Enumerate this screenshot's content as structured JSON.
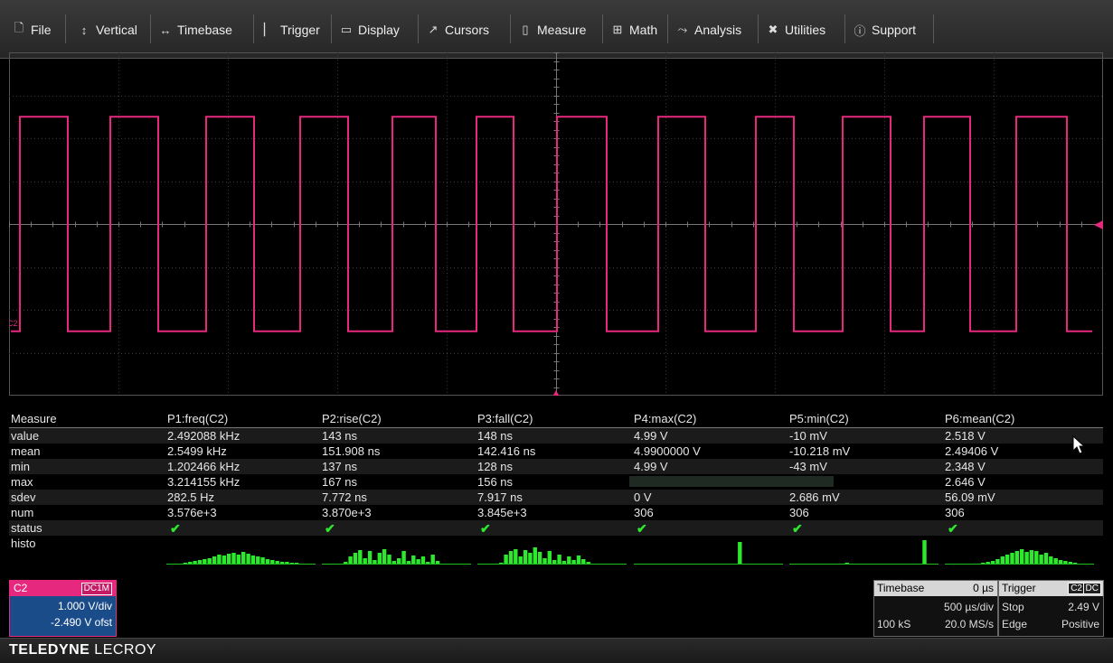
{
  "menu": {
    "items": [
      {
        "label": "File",
        "icon": "file-icon"
      },
      {
        "label": "Vertical",
        "icon": "vertical-arrows-icon"
      },
      {
        "label": "Timebase",
        "icon": "horizontal-arrows-icon"
      },
      {
        "label": "Trigger",
        "icon": "trigger-icon"
      },
      {
        "label": "Display",
        "icon": "display-icon"
      },
      {
        "label": "Cursors",
        "icon": "cursors-icon"
      },
      {
        "label": "Measure",
        "icon": "measure-icon"
      },
      {
        "label": "Math",
        "icon": "math-icon"
      },
      {
        "label": "Analysis",
        "icon": "analysis-icon"
      },
      {
        "label": "Utilities",
        "icon": "utilities-icon"
      },
      {
        "label": "Support",
        "icon": "support-icon"
      }
    ]
  },
  "waveform": {
    "channel_label": "C2",
    "color": "#e6287f",
    "type": "square",
    "high_level_v": 4.99,
    "low_level_v": -0.01
  },
  "measure": {
    "header": [
      "Measure",
      "P1:freq(C2)",
      "P2:rise(C2)",
      "P3:fall(C2)",
      "P4:max(C2)",
      "P5:min(C2)",
      "P6:mean(C2)"
    ],
    "rows": [
      {
        "name": "value",
        "cells": [
          "2.492088 kHz",
          "143 ns",
          "148 ns",
          "4.99 V",
          "-10 mV",
          "2.518 V"
        ]
      },
      {
        "name": "mean",
        "cells": [
          "2.5499 kHz",
          "151.908 ns",
          "142.416 ns",
          "4.9900000 V",
          "-10.218 mV",
          "2.49406 V"
        ]
      },
      {
        "name": "min",
        "cells": [
          "1.202466 kHz",
          "137 ns",
          "128 ns",
          "4.99 V",
          "-43 mV",
          "2.348 V"
        ]
      },
      {
        "name": "max",
        "cells": [
          "3.214155 kHz",
          "167 ns",
          "156 ns",
          "",
          "",
          "2.646 V"
        ]
      },
      {
        "name": "sdev",
        "cells": [
          "282.5 Hz",
          "7.772 ns",
          "7.917 ns",
          "0 V",
          "2.686 mV",
          "56.09 mV"
        ]
      },
      {
        "name": "num",
        "cells": [
          "3.576e+3",
          "3.870e+3",
          "3.845e+3",
          "306",
          "306",
          "306"
        ]
      }
    ],
    "status_label": "status",
    "histo_label": "histo",
    "check_symbol": "✔"
  },
  "channel": {
    "name": "C2",
    "coupling": "DC1M",
    "scale": "1.000 V/div",
    "offset": "-2.490 V ofst"
  },
  "timebase": {
    "title": "Timebase",
    "delay": "0 µs",
    "scale": "500 µs/div",
    "samples": "100 kS",
    "rate": "20.0 MS/s"
  },
  "trigger": {
    "title": "Trigger",
    "source_tag": "C2",
    "coupling_tag": "DC",
    "mode": "Stop",
    "level": "2.49 V",
    "type": "Edge",
    "slope": "Positive"
  },
  "brand": {
    "name_bold": "TELEDYNE",
    "name_rest": "LECROY"
  }
}
